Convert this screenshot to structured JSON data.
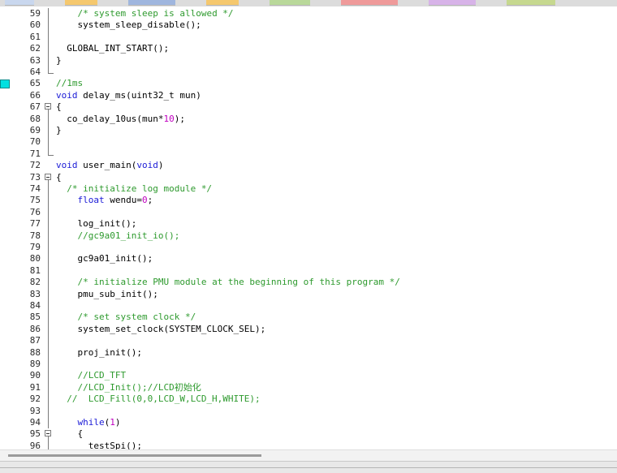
{
  "editor": {
    "lines": [
      {
        "n": "59",
        "fold": "bar",
        "segs": [
          {
            "t": "    "
          },
          {
            "t": "/* system sleep is allowed */",
            "c": "comment"
          }
        ]
      },
      {
        "n": "60",
        "fold": "bar",
        "segs": [
          {
            "t": "    system_sleep_disable();"
          }
        ]
      },
      {
        "n": "61",
        "fold": "bar",
        "segs": []
      },
      {
        "n": "62",
        "fold": "bar",
        "segs": [
          {
            "t": "  GLOBAL_INT_START();"
          }
        ]
      },
      {
        "n": "63",
        "fold": "bar",
        "segs": [
          {
            "t": "}"
          }
        ]
      },
      {
        "n": "64",
        "fold": "end",
        "segs": []
      },
      {
        "n": "65",
        "fold": "",
        "bp": true,
        "segs": [
          {
            "t": "//1ms",
            "c": "comment"
          }
        ]
      },
      {
        "n": "66",
        "fold": "",
        "segs": [
          {
            "t": "void",
            "c": "kw"
          },
          {
            "t": " delay_ms(uint32_t mun)"
          }
        ]
      },
      {
        "n": "67",
        "fold": "box",
        "segs": [
          {
            "t": "{"
          }
        ]
      },
      {
        "n": "68",
        "fold": "bar",
        "segs": [
          {
            "t": "  co_delay_10us(mun*"
          },
          {
            "t": "10",
            "c": "num"
          },
          {
            "t": ");"
          }
        ]
      },
      {
        "n": "69",
        "fold": "bar",
        "segs": [
          {
            "t": "}"
          }
        ]
      },
      {
        "n": "70",
        "fold": "bar",
        "segs": []
      },
      {
        "n": "71",
        "fold": "end",
        "segs": []
      },
      {
        "n": "72",
        "fold": "",
        "segs": [
          {
            "t": "void",
            "c": "kw"
          },
          {
            "t": " user_main("
          },
          {
            "t": "void",
            "c": "kw"
          },
          {
            "t": ")"
          }
        ]
      },
      {
        "n": "73",
        "fold": "box",
        "segs": [
          {
            "t": "{"
          }
        ]
      },
      {
        "n": "74",
        "fold": "bar",
        "segs": [
          {
            "t": "  "
          },
          {
            "t": "/* initialize log module */",
            "c": "comment"
          }
        ]
      },
      {
        "n": "75",
        "fold": "bar",
        "segs": [
          {
            "t": "    "
          },
          {
            "t": "float",
            "c": "kw"
          },
          {
            "t": " wendu="
          },
          {
            "t": "0",
            "c": "num"
          },
          {
            "t": ";"
          }
        ]
      },
      {
        "n": "76",
        "fold": "bar",
        "segs": []
      },
      {
        "n": "77",
        "fold": "bar",
        "segs": [
          {
            "t": "    log_init();"
          }
        ]
      },
      {
        "n": "78",
        "fold": "bar",
        "segs": [
          {
            "t": "    "
          },
          {
            "t": "//gc9a01_init_io();",
            "c": "comment"
          }
        ]
      },
      {
        "n": "79",
        "fold": "bar",
        "segs": []
      },
      {
        "n": "80",
        "fold": "bar",
        "segs": [
          {
            "t": "    gc9a01_init();"
          }
        ]
      },
      {
        "n": "81",
        "fold": "bar",
        "segs": []
      },
      {
        "n": "82",
        "fold": "bar",
        "segs": [
          {
            "t": "    "
          },
          {
            "t": "/* initialize PMU module at the beginning of this program */",
            "c": "comment"
          }
        ]
      },
      {
        "n": "83",
        "fold": "bar",
        "segs": [
          {
            "t": "    pmu_sub_init();"
          }
        ]
      },
      {
        "n": "84",
        "fold": "bar",
        "segs": []
      },
      {
        "n": "85",
        "fold": "bar",
        "segs": [
          {
            "t": "    "
          },
          {
            "t": "/* set system clock */",
            "c": "comment"
          }
        ]
      },
      {
        "n": "86",
        "fold": "bar",
        "segs": [
          {
            "t": "    system_set_clock(SYSTEM_CLOCK_SEL);"
          }
        ]
      },
      {
        "n": "87",
        "fold": "bar",
        "segs": []
      },
      {
        "n": "88",
        "fold": "bar",
        "segs": [
          {
            "t": "    proj_init();"
          }
        ]
      },
      {
        "n": "89",
        "fold": "bar",
        "segs": []
      },
      {
        "n": "90",
        "fold": "bar",
        "segs": [
          {
            "t": "    "
          },
          {
            "t": "//LCD_TFT",
            "c": "comment"
          }
        ]
      },
      {
        "n": "91",
        "fold": "bar",
        "segs": [
          {
            "t": "    "
          },
          {
            "t": "//LCD_Init();//LCD初始化",
            "c": "comment"
          }
        ]
      },
      {
        "n": "92",
        "fold": "bar",
        "segs": [
          {
            "t": "  "
          },
          {
            "t": "//  LCD_Fill(0,0,LCD_W,LCD_H,WHITE);",
            "c": "comment"
          }
        ]
      },
      {
        "n": "93",
        "fold": "bar",
        "segs": []
      },
      {
        "n": "94",
        "fold": "bar",
        "segs": [
          {
            "t": "    "
          },
          {
            "t": "while",
            "c": "kw"
          },
          {
            "t": "("
          },
          {
            "t": "1",
            "c": "num"
          },
          {
            "t": ")"
          }
        ]
      },
      {
        "n": "95",
        "fold": "box",
        "segs": [
          {
            "t": "    {"
          }
        ]
      },
      {
        "n": "96",
        "fold": "bar",
        "segs": [
          {
            "t": "      testSpi();"
          }
        ]
      }
    ]
  },
  "colors": {
    "comment": "#2e9a2e",
    "keyword": "#1a1ad6",
    "number": "#c000c0",
    "breakpoint": "#00e0e0"
  },
  "tabs": [
    {
      "color": "#c9d7ee"
    },
    {
      "color": "#f5c86e"
    },
    {
      "color": "#9fb6de"
    },
    {
      "color": "#f5c86e"
    },
    {
      "color": "#b9d89a"
    },
    {
      "color": "#ef9a9a"
    },
    {
      "color": "#d7b3e8"
    },
    {
      "color": "#c6d88f"
    }
  ]
}
